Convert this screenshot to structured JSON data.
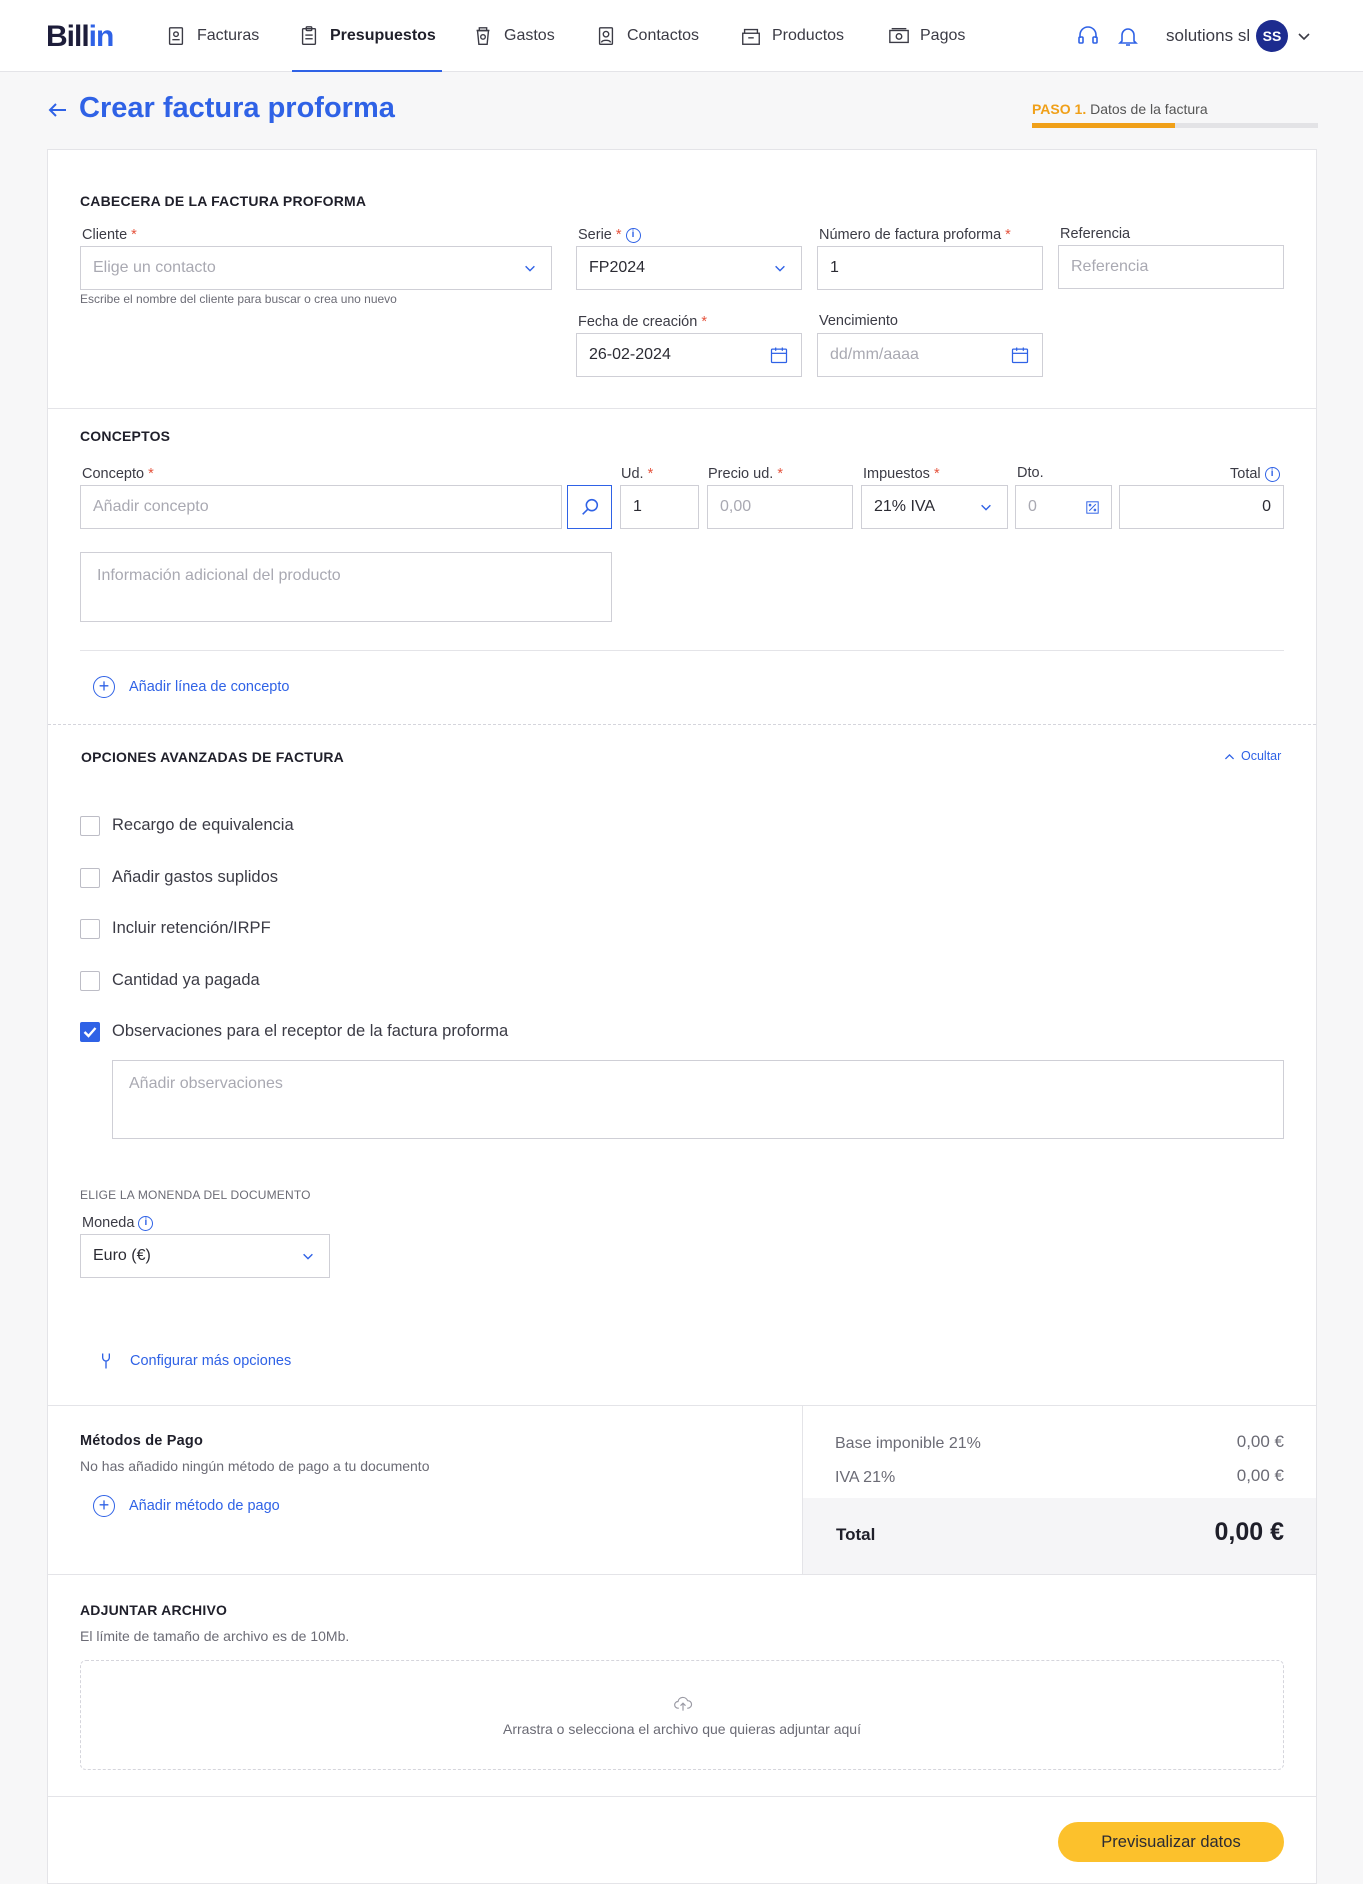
{
  "app": {
    "logo_left": "Bill",
    "logo_right": "in"
  },
  "nav": {
    "items": [
      {
        "label": "Facturas"
      },
      {
        "label": "Presupuestos"
      },
      {
        "label": "Gastos"
      },
      {
        "label": "Contactos"
      },
      {
        "label": "Productos"
      },
      {
        "label": "Pagos"
      }
    ],
    "user_name": "solutions sl",
    "user_initials": "SS"
  },
  "header": {
    "title": "Crear factura proforma",
    "step_num": "PASO 1.",
    "step_label": "Datos de la factura",
    "step_progress": 0.5
  },
  "cabecera": {
    "title": "CABECERA DE LA FACTURA PROFORMA",
    "cliente_label": "Cliente",
    "cliente_placeholder": "Elige un contacto",
    "cliente_hint": "Escribe el nombre del cliente para buscar o crea uno nuevo",
    "serie_label": "Serie",
    "serie_value": "FP2024",
    "numero_label": "Número de factura proforma",
    "numero_value": "1",
    "referencia_label": "Referencia",
    "referencia_placeholder": "Referencia",
    "fecha_label": "Fecha de creación",
    "fecha_value": "26-02-2024",
    "vencimiento_label": "Vencimiento",
    "vencimiento_placeholder": "dd/mm/aaaa",
    "info_glyph": "i"
  },
  "conceptos": {
    "title": "CONCEPTOS",
    "concepto_label": "Concepto",
    "concepto_placeholder": "Añadir concepto",
    "ud_label": "Ud.",
    "ud_value": "1",
    "precio_label": "Precio ud.",
    "precio_placeholder": "0,00",
    "impuestos_label": "Impuestos",
    "impuestos_value": "21% IVA",
    "dto_label": "Dto.",
    "dto_placeholder": "0",
    "total_label": "Total",
    "total_value": "0",
    "info_placeholder": "Información adicional del producto",
    "add_line": "Añadir línea de concepto",
    "required_mark": "*"
  },
  "avanzadas": {
    "title": "OPCIONES AVANZADAS DE FACTURA",
    "hide_label": "Ocultar",
    "options": [
      {
        "label": "Recargo de equivalencia",
        "checked": false
      },
      {
        "label": "Añadir gastos suplidos",
        "checked": false
      },
      {
        "label": "Incluir retención/IRPF",
        "checked": false
      },
      {
        "label": "Cantidad ya pagada",
        "checked": false
      },
      {
        "label": "Observaciones para el receptor de la factura proforma",
        "checked": true
      }
    ],
    "observaciones_placeholder": "Añadir observaciones",
    "moneda_section": "ELIGE LA MONENDA DEL DOCUMENTO",
    "moneda_label": "Moneda",
    "moneda_value": "Euro (€)",
    "config_more": "Configurar más opciones"
  },
  "pago": {
    "title": "Métodos de Pago",
    "empty_text": "No has añadido ningún método de pago a tu documento",
    "add_label": "Añadir método de pago"
  },
  "totales": {
    "base_label": "Base imponible 21%",
    "base_value": "0,00 €",
    "iva_label": "IVA 21%",
    "iva_value": "0,00 €",
    "total_label": "Total",
    "total_value": "0,00 €"
  },
  "adjuntar": {
    "title": "ADJUNTAR ARCHIVO",
    "limit_text": "El límite de tamaño de archivo es de 10Mb.",
    "drop_text": "Arrastra o selecciona el archivo que quieras adjuntar aquí"
  },
  "footer": {
    "preview_button": "Previsualizar datos"
  },
  "colors": {
    "accent": "#2f62e6",
    "step": "#f0a019",
    "primary_button": "#fcc12c"
  }
}
